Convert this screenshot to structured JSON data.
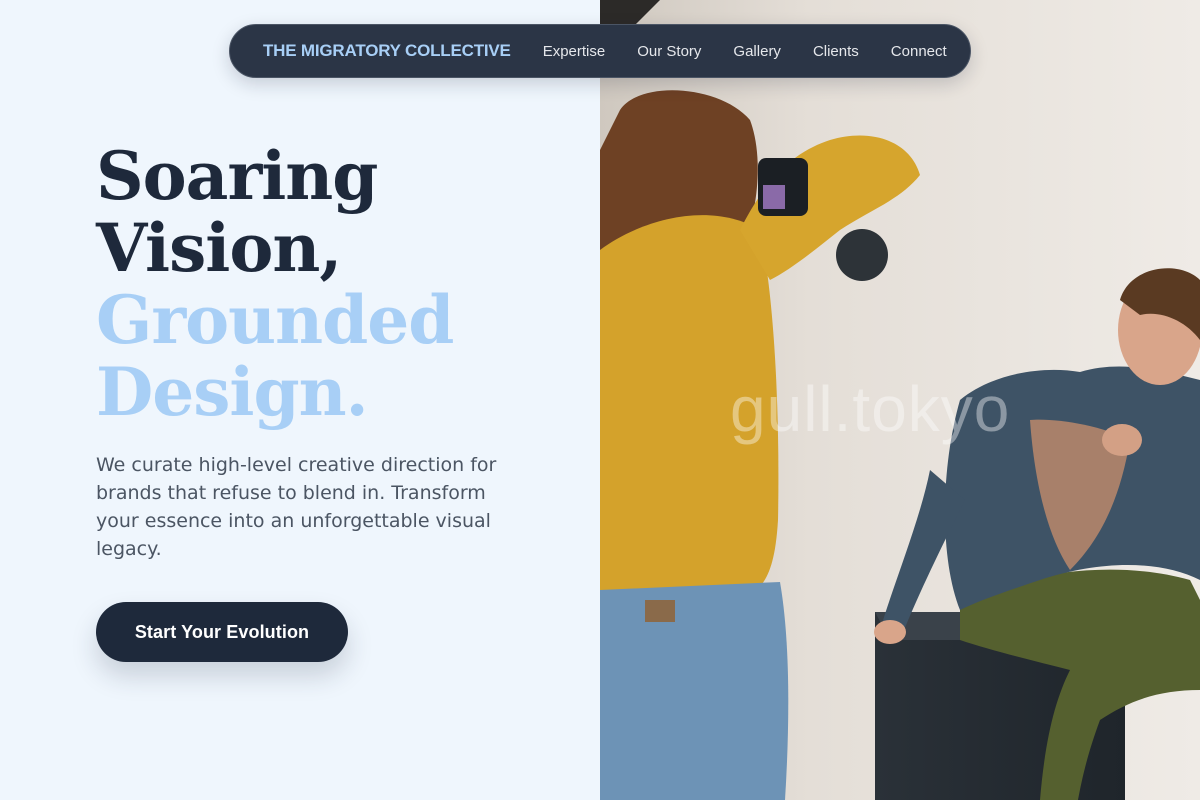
{
  "nav": {
    "brand": "THE MIGRATORY COLLECTIVE",
    "links": [
      "Expertise",
      "Our Story",
      "Gallery",
      "Clients",
      "Connect"
    ]
  },
  "hero": {
    "headline_dark": [
      "Soaring",
      "Vision,"
    ],
    "headline_light": [
      "Grounded",
      "Design."
    ],
    "description": "We curate high-level creative direction for brands that refuse to blend in. Transform your essence into an unforgettable visual legacy.",
    "cta_label": "Start Your Evolution"
  },
  "photo": {
    "watermark": "gull.tokyo"
  },
  "colors": {
    "background": "#eff6fd",
    "navy": "#1e293b",
    "accent_blue": "#a8cff6",
    "nav_bg": "#2b3546",
    "body_text": "#4b5563"
  }
}
